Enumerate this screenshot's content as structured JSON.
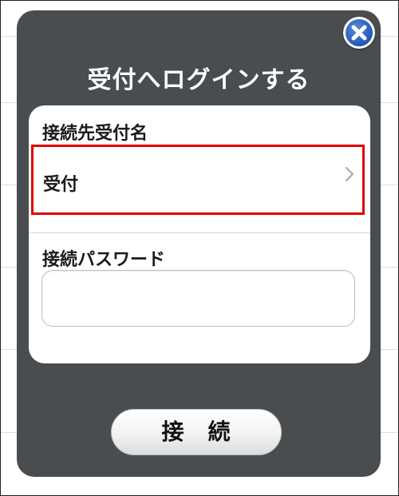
{
  "dialog": {
    "title": "受付へログインする",
    "close_icon": "close-icon",
    "destination": {
      "label": "接続先受付名",
      "value": "受付",
      "chevron_icon": "chevron-right-icon",
      "highlight_color": "#e00000"
    },
    "password": {
      "label": "接続パスワード",
      "value": "",
      "placeholder": ""
    },
    "connect_button": {
      "label": "接　続"
    }
  },
  "colors": {
    "dialog_background": "#4a4d50",
    "panel_background": "#ffffff",
    "close_button_blue": "#2457b8"
  }
}
